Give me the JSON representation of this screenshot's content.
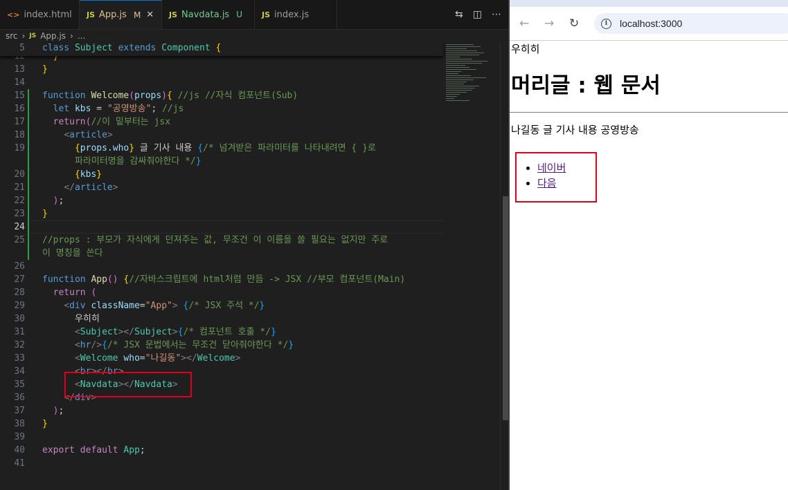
{
  "vscode": {
    "tabs": [
      {
        "icon": "<>",
        "label": "index.html",
        "status": ""
      },
      {
        "icon": "JS",
        "label": "App.js",
        "status": "M"
      },
      {
        "icon": "JS",
        "label": "Navdata.js",
        "status": "U"
      },
      {
        "icon": "JS",
        "label": "index.js",
        "status": ""
      }
    ],
    "breadcrumb": {
      "folder": "src",
      "icon": "JS",
      "file": "App.js",
      "more": "..."
    },
    "sticky_line": {
      "number": "5",
      "text": "class Subject extends Component {"
    },
    "lines": [
      {
        "number": "12",
        "text": "  }"
      },
      {
        "number": "13",
        "text": "}"
      },
      {
        "number": "14",
        "text": ""
      },
      {
        "number": "15",
        "text": "function Welcome(props){ //js //자식 컴포넌트(Sub)"
      },
      {
        "number": "16",
        "text": "  let kbs = \"공영방송\"; //js"
      },
      {
        "number": "17",
        "text": "  return(//이 밑부터는 jsx"
      },
      {
        "number": "18",
        "text": "    <article>"
      },
      {
        "number": "19",
        "text": "      {props.who} 글 기사 내용 {/* 넘겨받은 파라미터를 나타내려면 { }로"
      },
      {
        "number": "",
        "text": "      파라미터명을 감싸줘야한다 */}"
      },
      {
        "number": "20",
        "text": "      {kbs}"
      },
      {
        "number": "21",
        "text": "    </article>"
      },
      {
        "number": "22",
        "text": "  );"
      },
      {
        "number": "23",
        "text": "}"
      },
      {
        "number": "24",
        "text": ""
      },
      {
        "number": "25",
        "text": "//props : 부모가 자식에게 던져주는 값, 무조건 이 이름을 쓸 필요는 없지만 주로"
      },
      {
        "number": "",
        "text": "이 명칭을 쓴다"
      },
      {
        "number": "26",
        "text": ""
      },
      {
        "number": "27",
        "text": "function App() {//자바스크립트에 html처럼 만듬 -> JSX //부모 컴포넌트(Main)"
      },
      {
        "number": "28",
        "text": "  return ("
      },
      {
        "number": "29",
        "text": "    <div className=\"App\"> {/* JSX 주석 */}"
      },
      {
        "number": "30",
        "text": "      우히히"
      },
      {
        "number": "31",
        "text": "      <Subject></Subject>{/* 컴포넌트 호출 */}"
      },
      {
        "number": "32",
        "text": "      <hr/>{/* JSX 문법에서는 무조건 닫아줘야한다 */}"
      },
      {
        "number": "33",
        "text": "      <Welcome who=\"나길동\"></Welcome>"
      },
      {
        "number": "34",
        "text": "      <br></br>"
      },
      {
        "number": "35",
        "text": "      <Navdata></Navdata>"
      },
      {
        "number": "36",
        "text": "    </div>"
      },
      {
        "number": "37",
        "text": "  );"
      },
      {
        "number": "38",
        "text": "}"
      },
      {
        "number": "39",
        "text": ""
      },
      {
        "number": "40",
        "text": "export default App;"
      },
      {
        "number": "41",
        "text": ""
      }
    ]
  },
  "browser": {
    "url": "localhost:3000",
    "page": {
      "text_top": "우히히",
      "heading": "머리글 : 웹 문서",
      "welcome_text": "나길동 글 기사 내용 공영방송",
      "links": [
        "네이버",
        "다음"
      ]
    }
  }
}
